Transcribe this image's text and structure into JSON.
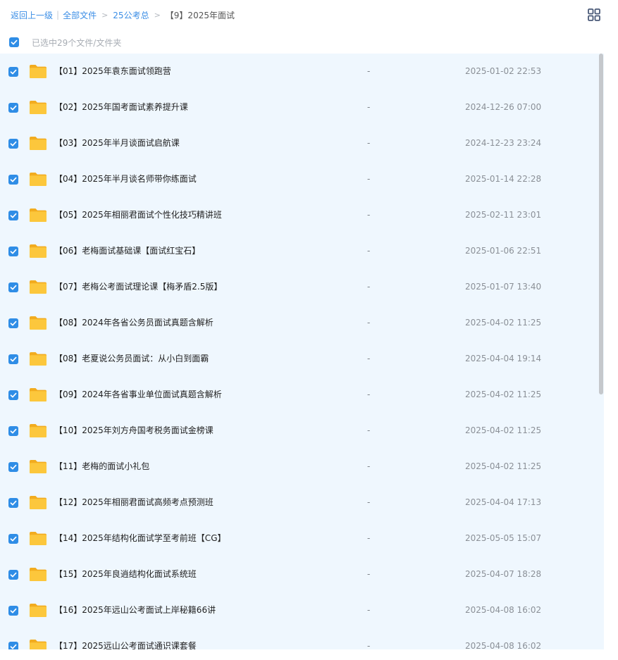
{
  "breadcrumb": {
    "back_label": "返回上一级",
    "root_label": "全部文件",
    "parent_label": "25公考总",
    "current_label": "【9】2025年面试",
    "separator_bar": "|",
    "separator_arrow": ">"
  },
  "toolbar": {
    "view_toggle_icon": "grid-view-icon"
  },
  "selection": {
    "all_checked": true,
    "status_text": "已选中29个文件/文件夹"
  },
  "files": [
    {
      "name": "【01】2025年袁东面试领跑营",
      "size": "-",
      "date": "2025-01-02 22:53",
      "checked": true
    },
    {
      "name": "【02】2025年国考面试素养提升课",
      "size": "-",
      "date": "2024-12-26 07:00",
      "checked": true
    },
    {
      "name": "【03】2025年半月谈面试启航课",
      "size": "-",
      "date": "2024-12-23 23:24",
      "checked": true
    },
    {
      "name": "【04】2025年半月谈名师带你练面试",
      "size": "-",
      "date": "2025-01-14 22:28",
      "checked": true
    },
    {
      "name": "【05】2025年相丽君面试个性化技巧精讲班",
      "size": "-",
      "date": "2025-02-11 23:01",
      "checked": true
    },
    {
      "name": "【06】老梅面试基础课【面试红宝石】",
      "size": "-",
      "date": "2025-01-06 22:51",
      "checked": true
    },
    {
      "name": "【07】老梅公考面试理论课【梅矛盾2.5版】",
      "size": "-",
      "date": "2025-01-07 13:40",
      "checked": true
    },
    {
      "name": "【08】2024年各省公务员面试真题含解析",
      "size": "-",
      "date": "2025-04-02 11:25",
      "checked": true
    },
    {
      "name": "【08】老夏说公务员面试：从小白到面霸",
      "size": "-",
      "date": "2025-04-04 19:14",
      "checked": true
    },
    {
      "name": "【09】2024年各省事业单位面试真题含解析",
      "size": "-",
      "date": "2025-04-02 11:25",
      "checked": true
    },
    {
      "name": "【10】2025年刘方舟国考税务面试金榜课",
      "size": "-",
      "date": "2025-04-02 11:25",
      "checked": true
    },
    {
      "name": "【11】老梅的面试小礼包",
      "size": "-",
      "date": "2025-04-02 11:25",
      "checked": true
    },
    {
      "name": "【12】2025年相丽君面试高频考点预测班",
      "size": "-",
      "date": "2025-04-04 17:13",
      "checked": true
    },
    {
      "name": "【14】2025年结构化面试学至考前班【CG】",
      "size": "-",
      "date": "2025-05-05 15:07",
      "checked": true
    },
    {
      "name": "【15】2025年良逍结构化面试系统班",
      "size": "-",
      "date": "2025-04-07 18:28",
      "checked": true
    },
    {
      "name": "【16】2025年远山公考面试上岸秘籍66讲",
      "size": "-",
      "date": "2025-04-08 16:02",
      "checked": true
    },
    {
      "name": "【17】2025远山公考面试通识课套餐",
      "size": "-",
      "date": "2025-04-08 16:02",
      "checked": true
    }
  ],
  "icons": {
    "row_icon": "folder-icon",
    "checkbox_icon": "checkmark-icon"
  },
  "colors": {
    "accent": "#2f8de6",
    "link": "#3b8ee6",
    "list_background": "#eff7fe",
    "folder": "#fcc73c"
  },
  "scrollbar": {
    "position_fraction": 0.0,
    "visible_fraction": 0.57
  }
}
